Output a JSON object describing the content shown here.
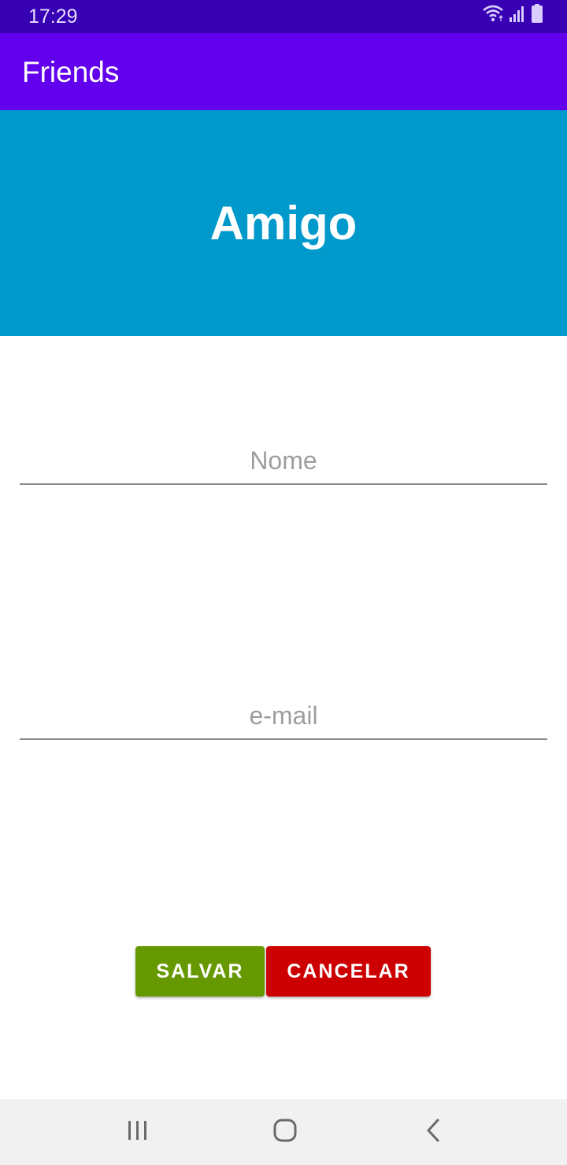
{
  "status_bar": {
    "time": "17:29",
    "icons": [
      "wifi-icon",
      "signal-icon",
      "battery-icon"
    ]
  },
  "app_bar": {
    "title": "Friends",
    "color": "#6200ee"
  },
  "banner": {
    "title": "Amigo",
    "color": "#0099cc"
  },
  "form": {
    "name_placeholder": "Nome",
    "name_value": "",
    "email_placeholder": "e-mail",
    "email_value": ""
  },
  "actions": {
    "save_label": "SALVAR",
    "save_color": "#669900",
    "cancel_label": "CANCELAR",
    "cancel_color": "#cc0000"
  },
  "nav_bar": {
    "buttons": [
      "recents-icon",
      "home-icon",
      "back-icon"
    ]
  }
}
